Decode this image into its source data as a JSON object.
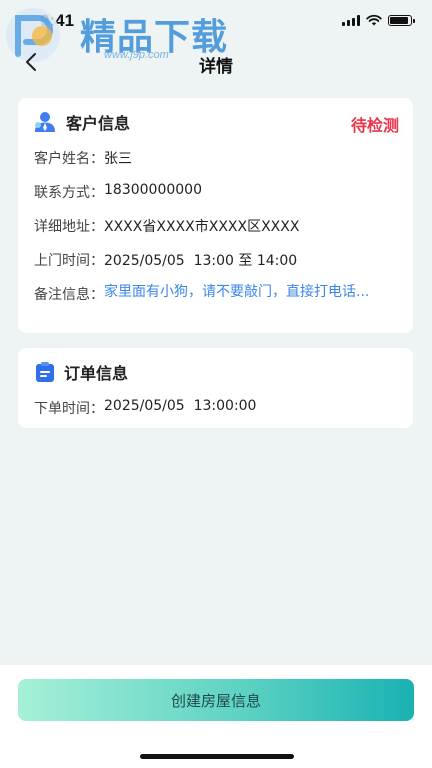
{
  "status_bar": {
    "time": "9:41"
  },
  "watermark": {
    "brand": "精品下载",
    "url": "www.j9p.com"
  },
  "nav": {
    "title": "详情"
  },
  "customer_card": {
    "title": "客户信息",
    "status": "待检测",
    "rows": [
      {
        "label": "客户姓名：",
        "value": "张三"
      },
      {
        "label": "联系方式：",
        "value": "18300000000"
      },
      {
        "label": "详细地址：",
        "value": "XXXX省XXXX市XXXX区XXXX"
      },
      {
        "label": "上门时间：",
        "value": "2025/05/05  13:00 至 14:00"
      },
      {
        "label": "备注信息：",
        "value": "家里面有小狗，请不要敲门，直接打电话..."
      }
    ]
  },
  "order_card": {
    "title": "订单信息",
    "rows": [
      {
        "label": "下单时间：",
        "value": "2025/05/05  13:00:00"
      }
    ]
  },
  "footer": {
    "create_button": "创建房屋信息"
  },
  "colors": {
    "accent_status": "#e8354a",
    "note_text": "#3b86e8",
    "button_gradient_start": "#a6f0d7",
    "button_gradient_end": "#19b2b2"
  }
}
